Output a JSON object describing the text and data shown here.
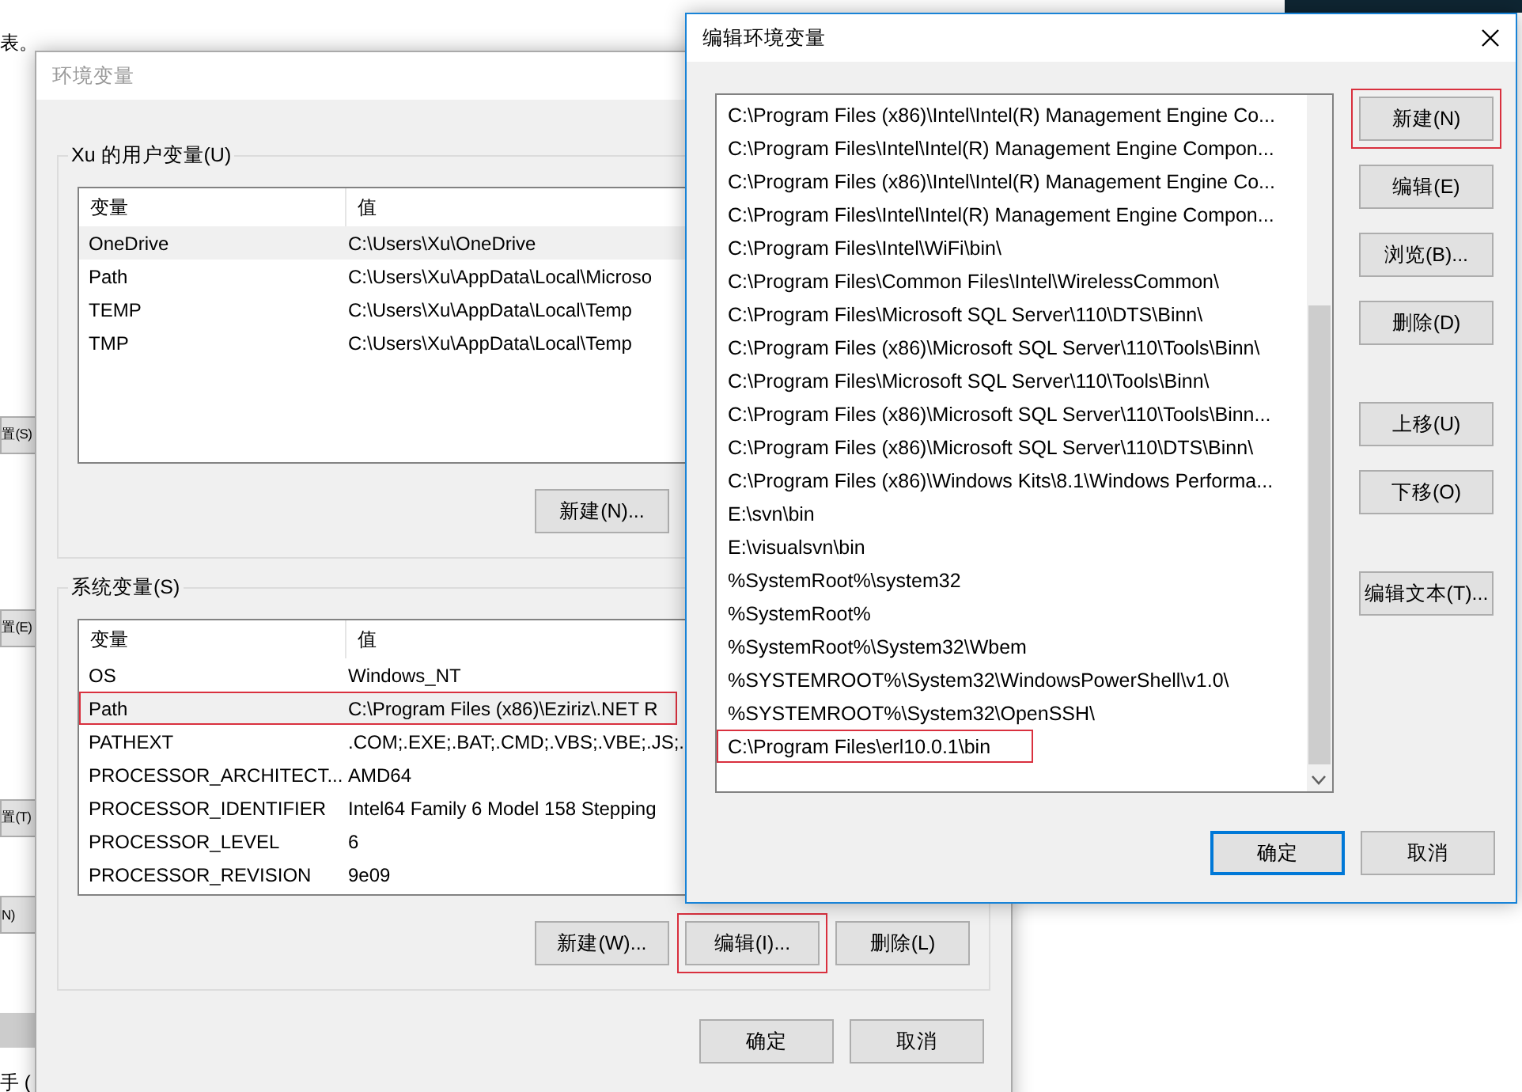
{
  "background_window": {
    "note": "表。",
    "buttons": [
      "置(S)",
      "置(E)",
      "置(T)",
      "N)"
    ],
    "footer": "手 ("
  },
  "env_window": {
    "title": "环境变量",
    "active": false,
    "groups": [
      {
        "label": "Xu 的用户变量(U)",
        "columns": [
          "变量",
          "值"
        ],
        "rows": [
          {
            "name": "OneDrive",
            "value": "C:\\Users\\Xu\\OneDrive",
            "selected": true,
            "annotated": false
          },
          {
            "name": "Path",
            "value": "C:\\Users\\Xu\\AppData\\Local\\Microso",
            "selected": false,
            "annotated": false
          },
          {
            "name": "TEMP",
            "value": "C:\\Users\\Xu\\AppData\\Local\\Temp",
            "selected": false,
            "annotated": false
          },
          {
            "name": "TMP",
            "value": "C:\\Users\\Xu\\AppData\\Local\\Temp",
            "selected": false,
            "annotated": false
          }
        ],
        "buttons": [
          {
            "label": "新建(N)...",
            "annotated": false
          }
        ]
      },
      {
        "label": "系统变量(S)",
        "columns": [
          "变量",
          "值"
        ],
        "rows": [
          {
            "name": "OS",
            "value": "Windows_NT",
            "selected": false,
            "annotated": false
          },
          {
            "name": "Path",
            "value": "C:\\Program Files (x86)\\Eziriz\\.NET R",
            "selected": true,
            "annotated": true
          },
          {
            "name": "PATHEXT",
            "value": ".COM;.EXE;.BAT;.CMD;.VBS;.VBE;.JS;.",
            "selected": false,
            "annotated": false
          },
          {
            "name": "PROCESSOR_ARCHITECT...",
            "value": "AMD64",
            "selected": false,
            "annotated": false
          },
          {
            "name": "PROCESSOR_IDENTIFIER",
            "value": "Intel64 Family 6 Model 158 Stepping",
            "selected": false,
            "annotated": false
          },
          {
            "name": "PROCESSOR_LEVEL",
            "value": "6",
            "selected": false,
            "annotated": false
          },
          {
            "name": "PROCESSOR_REVISION",
            "value": "9e09",
            "selected": false,
            "annotated": false
          }
        ],
        "buttons": [
          {
            "label": "新建(W)...",
            "annotated": false
          },
          {
            "label": "编辑(I)...",
            "annotated": true
          },
          {
            "label": "删除(L)",
            "annotated": false
          }
        ]
      }
    ],
    "buttons": [
      {
        "label": "确定",
        "default": false
      },
      {
        "label": "取消",
        "default": false
      }
    ]
  },
  "edit_dialog": {
    "title": "编辑环境变量",
    "active": true,
    "items": [
      {
        "text": "C:\\Program Files (x86)\\Intel\\Intel(R) Management Engine Co...",
        "annotated": false
      },
      {
        "text": "C:\\Program Files\\Intel\\Intel(R) Management Engine Compon...",
        "annotated": false
      },
      {
        "text": "C:\\Program Files (x86)\\Intel\\Intel(R) Management Engine Co...",
        "annotated": false
      },
      {
        "text": "C:\\Program Files\\Intel\\Intel(R) Management Engine Compon...",
        "annotated": false
      },
      {
        "text": "C:\\Program Files\\Intel\\WiFi\\bin\\",
        "annotated": false
      },
      {
        "text": "C:\\Program Files\\Common Files\\Intel\\WirelessCommon\\",
        "annotated": false
      },
      {
        "text": "C:\\Program Files\\Microsoft SQL Server\\110\\DTS\\Binn\\",
        "annotated": false
      },
      {
        "text": "C:\\Program Files (x86)\\Microsoft SQL Server\\110\\Tools\\Binn\\",
        "annotated": false
      },
      {
        "text": "C:\\Program Files\\Microsoft SQL Server\\110\\Tools\\Binn\\",
        "annotated": false
      },
      {
        "text": "C:\\Program Files (x86)\\Microsoft SQL Server\\110\\Tools\\Binn...",
        "annotated": false
      },
      {
        "text": "C:\\Program Files (x86)\\Microsoft SQL Server\\110\\DTS\\Binn\\",
        "annotated": false
      },
      {
        "text": "C:\\Program Files (x86)\\Windows Kits\\8.1\\Windows Performa...",
        "annotated": false
      },
      {
        "text": "E:\\svn\\bin",
        "annotated": false
      },
      {
        "text": "E:\\visualsvn\\bin",
        "annotated": false
      },
      {
        "text": "%SystemRoot%\\system32",
        "annotated": false
      },
      {
        "text": "%SystemRoot%",
        "annotated": false
      },
      {
        "text": "%SystemRoot%\\System32\\Wbem",
        "annotated": false
      },
      {
        "text": "%SYSTEMROOT%\\System32\\WindowsPowerShell\\v1.0\\",
        "annotated": false
      },
      {
        "text": "%SYSTEMROOT%\\System32\\OpenSSH\\",
        "annotated": false
      },
      {
        "text": "C:\\Program Files\\erl10.0.1\\bin",
        "annotated": true
      }
    ],
    "button_groups": [
      [
        {
          "label": "新建(N)",
          "annotated": true
        },
        {
          "label": "编辑(E)",
          "annotated": false
        },
        {
          "label": "浏览(B)...",
          "annotated": false
        },
        {
          "label": "删除(D)",
          "annotated": false
        }
      ],
      [
        {
          "label": "上移(U)",
          "annotated": false
        },
        {
          "label": "下移(O)",
          "annotated": false
        }
      ],
      [
        {
          "label": "编辑文本(T)...",
          "annotated": false
        }
      ]
    ],
    "buttons": [
      {
        "label": "确定",
        "default": true
      },
      {
        "label": "取消",
        "default": false
      }
    ]
  }
}
